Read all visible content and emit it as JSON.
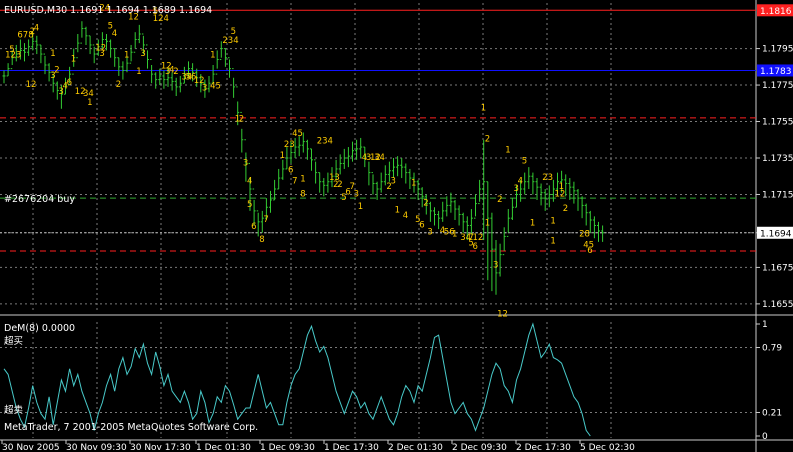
{
  "header": {
    "main_title": "EURUSD,M30  1.1691 1.1694 1.1689 1.1694",
    "indicator_title": "DeM(8) 0.0000",
    "buy_label": "#2676204 buy",
    "copyright": "MetaTrader, 7 2001-2005 MetaQuotes Software Corp.",
    "overbought_label": "超买",
    "oversold_label": "超卖"
  },
  "colors": {
    "background": "#000000",
    "grid": "#7a7a7a",
    "bars": "#33cc33",
    "numbers": "#ffcc00",
    "indicator": "#48c9c9",
    "red_line": "#ff2020",
    "blue_line": "#1010ff",
    "green_dash": "#33aa33",
    "text": "#ffffff"
  },
  "chart_data": [
    {
      "type": "bar",
      "title": "EURUSD,M30  1.1691 1.1694 1.1689 1.1694",
      "y_ticks": [
        "1.1795",
        "1.1775",
        "1.1755",
        "1.1735",
        "1.1715",
        "1.1694",
        "1.1675",
        "1.1655"
      ],
      "x_ticks": [
        "30 Nov 2005",
        "30 Nov 09:30",
        "30 Nov 17:30",
        "1 Dec 01:30",
        "1 Dec 09:30",
        "1 Dec 17:30",
        "2 Dec 01:30",
        "2 Dec 09:30",
        "2 Dec 17:30",
        "5 Dec 02:30"
      ],
      "ylim": [
        1.165,
        1.182
      ],
      "grid": true,
      "current_price": "1.1694",
      "price_tags": [
        {
          "label": "1.1816",
          "value": 1.1816,
          "color": "#ff2020"
        },
        {
          "label": "1.1783",
          "value": 1.1783,
          "color": "#1010ff"
        },
        {
          "label": "1.1694",
          "value": 1.1694,
          "color": "#ffffff"
        }
      ],
      "levels": [
        {
          "value": 1.1816,
          "style": "solid",
          "color": "#ff2020"
        },
        {
          "value": 1.1783,
          "style": "solid",
          "color": "#1010ff"
        },
        {
          "value": 1.1757,
          "style": "dash",
          "color": "#ff2020"
        },
        {
          "value": 1.1713,
          "style": "dash",
          "color": "#33aa33"
        },
        {
          "value": 1.1694,
          "style": "dot",
          "color": "#bbbbbb"
        },
        {
          "value": 1.1684,
          "style": "dash",
          "color": "#ff2020"
        }
      ],
      "close": [
        1.178,
        1.1784,
        1.179,
        1.1792,
        1.1794,
        1.1793,
        1.1796,
        1.1799,
        1.1797,
        1.1792,
        1.1786,
        1.1782,
        1.1776,
        1.1772,
        1.177,
        1.1775,
        1.1781,
        1.179,
        1.1798,
        1.1806,
        1.1802,
        1.1797,
        1.1792,
        1.1796,
        1.18,
        1.1799,
        1.1795,
        1.179,
        1.1785,
        1.1783,
        1.1787,
        1.1793,
        1.18,
        1.1803,
        1.1797,
        1.1789,
        1.1781,
        1.1778,
        1.178,
        1.1778,
        1.1779,
        1.1777,
        1.1774,
        1.1776,
        1.1781,
        1.1784,
        1.1782,
        1.1779,
        1.1776,
        1.1773,
        1.1776,
        1.1781,
        1.1789,
        1.1795,
        1.179,
        1.1784,
        1.1774,
        1.176,
        1.1745,
        1.1732,
        1.1718,
        1.1706,
        1.17,
        1.1702,
        1.1708,
        1.1712,
        1.1718,
        1.1724,
        1.1729,
        1.1735,
        1.1738,
        1.1741,
        1.1742,
        1.1744,
        1.174,
        1.1734,
        1.1727,
        1.1722,
        1.172,
        1.1722,
        1.1725,
        1.1729,
        1.1732,
        1.1735,
        1.1736,
        1.1739,
        1.174,
        1.1741,
        1.1736,
        1.1727,
        1.1721,
        1.1718,
        1.1722,
        1.1726,
        1.1728,
        1.173,
        1.1731,
        1.173,
        1.1727,
        1.1724,
        1.1722,
        1.1718,
        1.1714,
        1.171,
        1.1706,
        1.1704,
        1.1702,
        1.1706,
        1.1709,
        1.1711,
        1.1707,
        1.1704,
        1.17,
        1.1698,
        1.1702,
        1.171,
        1.1718,
        1.1722,
        1.1702,
        1.1685,
        1.1672,
        1.1682,
        1.1692,
        1.1702,
        1.1708,
        1.1715,
        1.1718,
        1.1722,
        1.1725,
        1.1722,
        1.1719,
        1.1716,
        1.1713,
        1.1715,
        1.1718,
        1.1722,
        1.1723,
        1.1721,
        1.1719,
        1.1717,
        1.1713,
        1.1709,
        1.1705,
        1.1701,
        1.1698,
        1.1695,
        1.1694
      ],
      "high": [
        1.1783,
        1.1787,
        1.1794,
        1.1797,
        1.18,
        1.1798,
        1.18,
        1.1804,
        1.1802,
        1.1797,
        1.1791,
        1.1787,
        1.1781,
        1.1777,
        1.1775,
        1.1779,
        1.1785,
        1.1795,
        1.1803,
        1.181,
        1.1807,
        1.1802,
        1.1796,
        1.18,
        1.1804,
        1.1803,
        1.18,
        1.1795,
        1.179,
        1.1788,
        1.1791,
        1.1797,
        1.1804,
        1.1808,
        1.1802,
        1.1794,
        1.1786,
        1.1782,
        1.1784,
        1.1783,
        1.1784,
        1.1782,
        1.1779,
        1.178,
        1.1785,
        1.1788,
        1.1787,
        1.1784,
        1.1781,
        1.1778,
        1.178,
        1.1786,
        1.1794,
        1.1799,
        1.1795,
        1.1789,
        1.1779,
        1.1766,
        1.1751,
        1.1738,
        1.1724,
        1.1712,
        1.1705,
        1.1706,
        1.1713,
        1.1717,
        1.1723,
        1.1729,
        1.1734,
        1.1741,
        1.1744,
        1.1746,
        1.1747,
        1.1749,
        1.1745,
        1.174,
        1.1733,
        1.1727,
        1.1724,
        1.1727,
        1.173,
        1.1734,
        1.1737,
        1.174,
        1.1741,
        1.1744,
        1.1745,
        1.1746,
        1.1741,
        1.1733,
        1.1726,
        1.1722,
        1.1727,
        1.1731,
        1.1733,
        1.1735,
        1.1736,
        1.1735,
        1.1732,
        1.1729,
        1.1727,
        1.1723,
        1.1719,
        1.1715,
        1.1711,
        1.1708,
        1.1706,
        1.1711,
        1.1714,
        1.1716,
        1.1712,
        1.1709,
        1.1705,
        1.1703,
        1.1707,
        1.1715,
        1.1723,
        1.1745,
        1.1722,
        1.1705,
        1.169,
        1.1688,
        1.1697,
        1.1707,
        1.1713,
        1.172,
        1.1723,
        1.1727,
        1.173,
        1.1727,
        1.1724,
        1.1721,
        1.1718,
        1.172,
        1.1723,
        1.1727,
        1.1728,
        1.1726,
        1.1724,
        1.1722,
        1.1718,
        1.1714,
        1.171,
        1.1706,
        1.1703,
        1.17,
        1.1698
      ],
      "low": [
        1.1776,
        1.178,
        1.1786,
        1.1788,
        1.1789,
        1.1788,
        1.1791,
        1.1794,
        1.1792,
        1.1787,
        1.1781,
        1.1777,
        1.1771,
        1.1767,
        1.1762,
        1.177,
        1.1776,
        1.1785,
        1.1793,
        1.1801,
        1.1797,
        1.1792,
        1.1787,
        1.1791,
        1.1795,
        1.1794,
        1.179,
        1.1785,
        1.178,
        1.1778,
        1.1782,
        1.1788,
        1.1795,
        1.1798,
        1.1792,
        1.1784,
        1.1776,
        1.1773,
        1.1775,
        1.1773,
        1.1774,
        1.1772,
        1.1769,
        1.1771,
        1.1776,
        1.1779,
        1.1777,
        1.1774,
        1.1771,
        1.1768,
        1.1771,
        1.1776,
        1.1784,
        1.179,
        1.1785,
        1.1779,
        1.1768,
        1.1753,
        1.1738,
        1.1722,
        1.1706,
        1.1698,
        1.1692,
        1.1694,
        1.1701,
        1.1705,
        1.1712,
        1.1718,
        1.1723,
        1.1729,
        1.1732,
        1.1735,
        1.1736,
        1.1738,
        1.1734,
        1.1728,
        1.1721,
        1.1716,
        1.1714,
        1.1716,
        1.1719,
        1.1723,
        1.1726,
        1.1729,
        1.173,
        1.1733,
        1.1734,
        1.1735,
        1.173,
        1.172,
        1.1715,
        1.1712,
        1.1716,
        1.172,
        1.1722,
        1.1724,
        1.1725,
        1.1724,
        1.1721,
        1.1718,
        1.1716,
        1.1712,
        1.1708,
        1.1704,
        1.17,
        1.1698,
        1.1696,
        1.17,
        1.1703,
        1.1705,
        1.1701,
        1.1698,
        1.1694,
        1.169,
        1.1693,
        1.1703,
        1.1711,
        1.169,
        1.1668,
        1.1662,
        1.166,
        1.167,
        1.1684,
        1.1694,
        1.1701,
        1.1708,
        1.1711,
        1.1715,
        1.1718,
        1.1715,
        1.1712,
        1.1709,
        1.1706,
        1.1708,
        1.1711,
        1.1715,
        1.1716,
        1.1714,
        1.1712,
        1.171,
        1.1706,
        1.1702,
        1.1698,
        1.1694,
        1.1691,
        1.1689,
        1.1689
      ]
    },
    {
      "type": "line",
      "title": "DeM(8) 0.0000",
      "name": "DeM(8)",
      "y_ticks": [
        "1",
        "0.79",
        "0.21",
        "0"
      ],
      "ylim": [
        0,
        1
      ],
      "levels": [
        0.79,
        0.21
      ],
      "values": [
        0.6,
        0.55,
        0.4,
        0.25,
        0.15,
        0.08,
        0.25,
        0.45,
        0.3,
        0.2,
        0.15,
        0.35,
        0.1,
        0.3,
        0.5,
        0.4,
        0.6,
        0.45,
        0.55,
        0.4,
        0.3,
        0.2,
        0.05,
        0.2,
        0.3,
        0.45,
        0.55,
        0.4,
        0.6,
        0.7,
        0.55,
        0.62,
        0.78,
        0.7,
        0.82,
        0.65,
        0.55,
        0.75,
        0.62,
        0.45,
        0.55,
        0.4,
        0.35,
        0.3,
        0.4,
        0.3,
        0.15,
        0.2,
        0.4,
        0.3,
        0.12,
        0.2,
        0.35,
        0.3,
        0.45,
        0.4,
        0.28,
        0.15,
        0.2,
        0.25,
        0.25,
        0.4,
        0.55,
        0.4,
        0.25,
        0.3,
        0.2,
        0.1,
        0.1,
        0.3,
        0.45,
        0.55,
        0.6,
        0.75,
        0.9,
        0.98,
        0.85,
        0.75,
        0.8,
        0.7,
        0.55,
        0.4,
        0.3,
        0.2,
        0.3,
        0.4,
        0.35,
        0.25,
        0.3,
        0.2,
        0.15,
        0.25,
        0.35,
        0.25,
        0.15,
        0.1,
        0.2,
        0.35,
        0.45,
        0.4,
        0.3,
        0.45,
        0.4,
        0.55,
        0.7,
        0.88,
        0.9,
        0.7,
        0.5,
        0.3,
        0.2,
        0.25,
        0.3,
        0.2,
        0.15,
        0.05,
        0.15,
        0.25,
        0.4,
        0.55,
        0.65,
        0.6,
        0.45,
        0.4,
        0.3,
        0.5,
        0.6,
        0.75,
        0.9,
        1.0,
        0.85,
        0.7,
        0.75,
        0.82,
        0.7,
        0.68,
        0.65,
        0.55,
        0.45,
        0.35,
        0.3,
        0.2,
        0.05,
        0.0
      ]
    }
  ],
  "fractal_labels": [
    {
      "text": "123",
      "bar": 1,
      "price": 1.179
    },
    {
      "text": "5",
      "bar": 2,
      "price": 1.1793
    },
    {
      "text": "678",
      "bar": 4,
      "price": 1.1801
    },
    {
      "text": "12",
      "bar": 6,
      "price": 1.1774
    },
    {
      "text": "2",
      "bar": 7,
      "price": 1.1803
    },
    {
      "text": "4",
      "bar": 8,
      "price": 1.1805
    },
    {
      "text": "1",
      "bar": 12,
      "price": 1.1791
    },
    {
      "text": "3",
      "bar": 12,
      "price": 1.1779
    },
    {
      "text": "2",
      "bar": 13,
      "price": 1.1782
    },
    {
      "text": "3",
      "bar": 14,
      "price": 1.177
    },
    {
      "text": "4",
      "bar": 15,
      "price": 1.1773
    },
    {
      "text": "6",
      "bar": 16,
      "price": 1.1775
    },
    {
      "text": "1",
      "bar": 17,
      "price": 1.1788
    },
    {
      "text": "12",
      "bar": 18,
      "price": 1.177
    },
    {
      "text": "34",
      "bar": 20,
      "price": 1.1769
    },
    {
      "text": "1",
      "bar": 21,
      "price": 1.1764
    },
    {
      "text": "12",
      "bar": 23,
      "price": 1.1794
    },
    {
      "text": "3",
      "bar": 24,
      "price": 1.1791
    },
    {
      "text": "24",
      "bar": 24,
      "price": 1.1816
    },
    {
      "text": "5",
      "bar": 26,
      "price": 1.1806
    },
    {
      "text": "4",
      "bar": 27,
      "price": 1.1802
    },
    {
      "text": "2",
      "bar": 28,
      "price": 1.1774
    },
    {
      "text": "1",
      "bar": 30,
      "price": 1.179
    },
    {
      "text": "12",
      "bar": 31,
      "price": 1.1811
    },
    {
      "text": "1",
      "bar": 33,
      "price": 1.1781
    },
    {
      "text": "3",
      "bar": 34,
      "price": 1.1791
    },
    {
      "text": "124",
      "bar": 37,
      "price": 1.181
    },
    {
      "text": "5",
      "bar": 37,
      "price": 1.1814
    },
    {
      "text": "12",
      "bar": 39,
      "price": 1.1784
    },
    {
      "text": "3",
      "bar": 40,
      "price": 1.1781
    },
    {
      "text": "4",
      "bar": 41,
      "price": 1.1782
    },
    {
      "text": "2",
      "bar": 42,
      "price": 1.1781
    },
    {
      "text": "34",
      "bar": 44,
      "price": 1.1778
    },
    {
      "text": "56",
      "bar": 45,
      "price": 1.1778
    },
    {
      "text": "12",
      "bar": 47,
      "price": 1.1776
    },
    {
      "text": "3",
      "bar": 49,
      "price": 1.1772
    },
    {
      "text": "45",
      "bar": 51,
      "price": 1.1773
    },
    {
      "text": "1",
      "bar": 51,
      "price": 1.179
    },
    {
      "text": "234",
      "bar": 54,
      "price": 1.1798
    },
    {
      "text": "5",
      "bar": 56,
      "price": 1.1803
    },
    {
      "text": "1",
      "bar": 57,
      "price": 1.1755
    },
    {
      "text": "2",
      "bar": 58,
      "price": 1.1755
    },
    {
      "text": "3",
      "bar": 59,
      "price": 1.1731
    },
    {
      "text": "4",
      "bar": 60,
      "price": 1.1721
    },
    {
      "text": "5",
      "bar": 60,
      "price": 1.1708
    },
    {
      "text": "6",
      "bar": 61,
      "price": 1.1696
    },
    {
      "text": "8",
      "bar": 63,
      "price": 1.1689
    },
    {
      "text": "7",
      "bar": 64,
      "price": 1.17
    },
    {
      "text": "45",
      "bar": 71,
      "price": 1.1747
    },
    {
      "text": "23",
      "bar": 69,
      "price": 1.1741
    },
    {
      "text": "1",
      "bar": 68,
      "price": 1.1735
    },
    {
      "text": "6",
      "bar": 70,
      "price": 1.1727
    },
    {
      "text": "7",
      "bar": 71,
      "price": 1.1721
    },
    {
      "text": "8",
      "bar": 73,
      "price": 1.1714
    },
    {
      "text": "1",
      "bar": 73,
      "price": 1.1722
    },
    {
      "text": "234",
      "bar": 77,
      "price": 1.1743
    },
    {
      "text": "13",
      "bar": 80,
      "price": 1.1723
    },
    {
      "text": "2",
      "bar": 81,
      "price": 1.1719
    },
    {
      "text": "2",
      "bar": 82,
      "price": 1.1719
    },
    {
      "text": "5",
      "bar": 83,
      "price": 1.1712
    },
    {
      "text": "6",
      "bar": 84,
      "price": 1.1715
    },
    {
      "text": "7",
      "bar": 85,
      "price": 1.1718
    },
    {
      "text": "3",
      "bar": 86,
      "price": 1.1714
    },
    {
      "text": "1",
      "bar": 87,
      "price": 1.1707
    },
    {
      "text": "4",
      "bar": 88,
      "price": 1.1734
    },
    {
      "text": "3",
      "bar": 89,
      "price": 1.1734
    },
    {
      "text": "12",
      "bar": 90,
      "price": 1.1734
    },
    {
      "text": "34",
      "bar": 91,
      "price": 1.1734
    },
    {
      "text": "2",
      "bar": 94,
      "price": 1.1718
    },
    {
      "text": "3",
      "bar": 95,
      "price": 1.1721
    },
    {
      "text": "1",
      "bar": 96,
      "price": 1.1705
    },
    {
      "text": "4",
      "bar": 98,
      "price": 1.1702
    },
    {
      "text": "1",
      "bar": 100,
      "price": 1.172
    },
    {
      "text": "5",
      "bar": 101,
      "price": 1.17
    },
    {
      "text": "6",
      "bar": 102,
      "price": 1.1697
    },
    {
      "text": "2",
      "bar": 103,
      "price": 1.1709
    },
    {
      "text": "3",
      "bar": 104,
      "price": 1.1693
    },
    {
      "text": "4",
      "bar": 107,
      "price": 1.1694
    },
    {
      "text": "56",
      "bar": 108,
      "price": 1.1693
    },
    {
      "text": "1",
      "bar": 110,
      "price": 1.1692
    },
    {
      "text": "34",
      "bar": 112,
      "price": 1.169
    },
    {
      "text": "5",
      "bar": 114,
      "price": 1.1687
    },
    {
      "text": "6",
      "bar": 115,
      "price": 1.1685
    },
    {
      "text": "7",
      "bar": 114,
      "price": 1.169
    },
    {
      "text": "12",
      "bar": 115,
      "price": 1.169
    },
    {
      "text": "1",
      "bar": 117,
      "price": 1.1761
    },
    {
      "text": "2",
      "bar": 118,
      "price": 1.1744
    },
    {
      "text": "1",
      "bar": 118,
      "price": 1.1698
    },
    {
      "text": "3",
      "bar": 120,
      "price": 1.1675
    },
    {
      "text": "12",
      "bar": 121,
      "price": 1.1648
    },
    {
      "text": "2",
      "bar": 121,
      "price": 1.1711
    },
    {
      "text": "1",
      "bar": 123,
      "price": 1.1738
    },
    {
      "text": "3",
      "bar": 125,
      "price": 1.1717
    },
    {
      "text": "4",
      "bar": 126,
      "price": 1.1721
    },
    {
      "text": "5",
      "bar": 127,
      "price": 1.1732
    },
    {
      "text": "1",
      "bar": 129,
      "price": 1.1698
    },
    {
      "text": "23",
      "bar": 132,
      "price": 1.1723
    },
    {
      "text": "1",
      "bar": 134,
      "price": 1.1699
    },
    {
      "text": "12",
      "bar": 135,
      "price": 1.1714
    },
    {
      "text": "1",
      "bar": 136,
      "price": 1.1718
    },
    {
      "text": "2",
      "bar": 137,
      "price": 1.1706
    },
    {
      "text": "28",
      "bar": 141,
      "price": 1.1692
    },
    {
      "text": "1",
      "bar": 134,
      "price": 1.1688
    },
    {
      "text": "45",
      "bar": 142,
      "price": 1.1686
    },
    {
      "text": "6",
      "bar": 143,
      "price": 1.1683
    }
  ]
}
